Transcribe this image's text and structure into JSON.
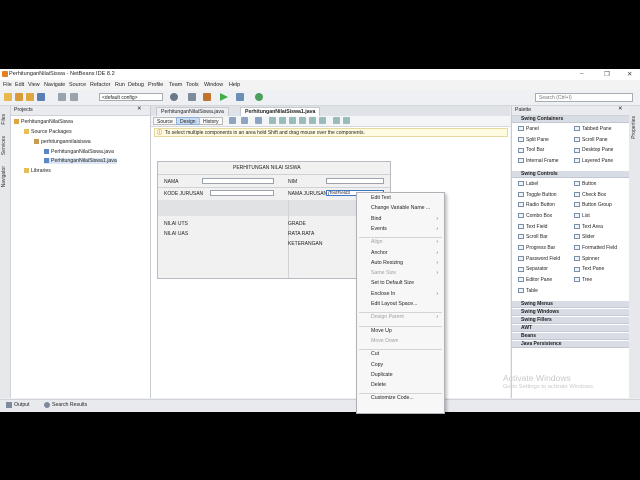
{
  "window": {
    "title": "PerhitunganNilaiSiswa - NetBeans IDE 8.2",
    "controls": [
      "–",
      "❐",
      "✕"
    ]
  },
  "menubar": [
    "File",
    "Edit",
    "View",
    "Navigate",
    "Source",
    "Refactor",
    "Run",
    "Debug",
    "Profile",
    "Team",
    "Tools",
    "Window",
    "Help"
  ],
  "toolbar": {
    "config": "<default config>",
    "search_placeholder": "Search (Ctrl+I)"
  },
  "side_tabs": {
    "left": [
      "Files",
      "Services",
      "Navigator"
    ],
    "right": [
      "Properties"
    ]
  },
  "projects": {
    "tab": "Projects",
    "tree": [
      {
        "label": "PerhitunganNilaiSiswa",
        "indent": 0,
        "icon": "project"
      },
      {
        "label": "Source Packages",
        "indent": 1,
        "icon": "folder"
      },
      {
        "label": "perhitungannilaisiswa",
        "indent": 2,
        "icon": "package"
      },
      {
        "label": "PerhitunganNilaiSiswa.java",
        "indent": 3,
        "icon": "java"
      },
      {
        "label": "PerhitunganNilaiSiswa1.java",
        "indent": 3,
        "icon": "java"
      },
      {
        "label": "Libraries",
        "indent": 1,
        "icon": "folder"
      }
    ]
  },
  "editor": {
    "tabs": [
      {
        "label": "PerhitunganNilaiSiswa.java",
        "active": false
      },
      {
        "label": "PerhitunganNilaiSiswa1.java",
        "active": true
      }
    ],
    "mode_buttons": [
      {
        "label": "Source",
        "on": false
      },
      {
        "label": "Design",
        "on": true
      },
      {
        "label": "History",
        "on": false
      }
    ],
    "info": "To select multiple components in an area hold Shift and drag mouse over the components."
  },
  "form": {
    "title": "PERHITUNGAN NILAI SISWA",
    "labels": {
      "nama": "NAMA",
      "nim": "NIM",
      "kode": "KODE JURUSAN",
      "nama_jurusan": "NAMA JURUSAN",
      "nilai_uts": "NILAI UTS",
      "nilai_uas": "NILAI UAS",
      "grade": "GRADE",
      "rata_rata": "RATA RATA",
      "keterangan": "KETERANGAN"
    },
    "selected_field": "jTextField3"
  },
  "palette": {
    "tab": "Palette",
    "categories": [
      {
        "name": "Swing Containers",
        "items": [
          "Panel",
          "Tabbed Pane",
          "Split Pane",
          "Scroll Pane",
          "Tool Bar",
          "Desktop Pane",
          "Internal Frame",
          "Layered Pane"
        ]
      },
      {
        "name": "Swing Controls",
        "items": [
          "Label",
          "Button",
          "Toggle Button",
          "Check Box",
          "Radio Button",
          "Button Group",
          "Combo Box",
          "List",
          "Text Field",
          "Text Area",
          "Scroll Bar",
          "Slider",
          "Progress Bar",
          "Formatted Field",
          "Password Field",
          "Spinner",
          "Separator",
          "Text Pane",
          "Editor Pane",
          "Tree",
          "Table"
        ]
      },
      {
        "name": "Swing Menus",
        "items": []
      },
      {
        "name": "Swing Windows",
        "items": []
      },
      {
        "name": "Swing Fillers",
        "items": []
      },
      {
        "name": "AWT",
        "items": []
      },
      {
        "name": "Beans",
        "items": []
      },
      {
        "name": "Java Persistence",
        "items": []
      }
    ]
  },
  "bottom_tabs": [
    "Output",
    "Search Results"
  ],
  "context_menu": [
    {
      "label": "Edit Text",
      "enabled": true,
      "sub": false
    },
    {
      "label": "Change Variable Name ...",
      "enabled": true,
      "sub": false
    },
    {
      "label": "Bind",
      "enabled": true,
      "sub": true
    },
    {
      "label": "Events",
      "enabled": true,
      "sub": true
    },
    {
      "sep": true
    },
    {
      "label": "Align",
      "enabled": false,
      "sub": true
    },
    {
      "label": "Anchor",
      "enabled": true,
      "sub": true
    },
    {
      "label": "Auto Resizing",
      "enabled": true,
      "sub": true
    },
    {
      "label": "Same Size",
      "enabled": false,
      "sub": true
    },
    {
      "label": "Set to Default Size",
      "enabled": true,
      "sub": false
    },
    {
      "label": "Enclose In",
      "enabled": true,
      "sub": true
    },
    {
      "label": "Edit Layout Space...",
      "enabled": true,
      "sub": false
    },
    {
      "sep": true
    },
    {
      "label": "Design Parent",
      "enabled": false,
      "sub": true
    },
    {
      "sep": true
    },
    {
      "label": "Move Up",
      "enabled": true,
      "sub": false
    },
    {
      "label": "Move Down",
      "enabled": false,
      "sub": false
    },
    {
      "sep": true
    },
    {
      "label": "Cut",
      "enabled": true,
      "sub": false
    },
    {
      "label": "Copy",
      "enabled": true,
      "sub": false
    },
    {
      "label": "Duplicate",
      "enabled": true,
      "sub": false
    },
    {
      "label": "Delete",
      "enabled": true,
      "sub": false
    },
    {
      "sep": true
    },
    {
      "label": "Customize Code...",
      "enabled": true,
      "sub": false
    }
  ],
  "watermark": {
    "line1": "Activate Windows",
    "line2": "Go to Settings to activate Windows."
  }
}
